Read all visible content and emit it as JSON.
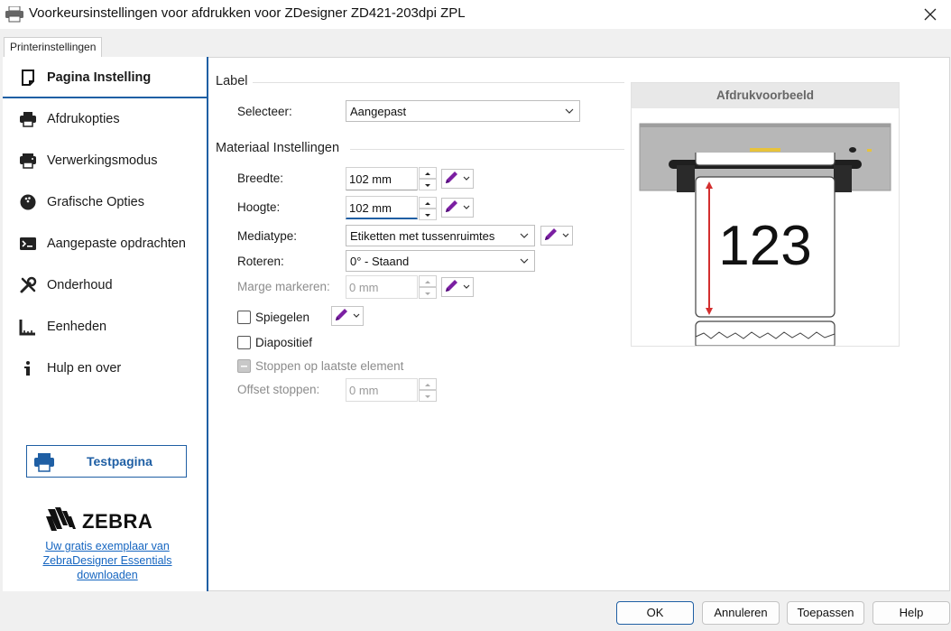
{
  "window": {
    "title": "Voorkeursinstellingen voor afdrukken voor ZDesigner ZD421-203dpi ZPL"
  },
  "tabs": [
    {
      "label": "Printerinstellingen"
    }
  ],
  "sidebar": {
    "items": [
      {
        "label": "Pagina Instelling",
        "icon": "page-icon",
        "active": true
      },
      {
        "label": "Afdrukopties",
        "icon": "printer-icon"
      },
      {
        "label": "Verwerkingsmodus",
        "icon": "printer-mode-icon"
      },
      {
        "label": "Grafische Opties",
        "icon": "bowling-ball-icon"
      },
      {
        "label": "Aangepaste opdrachten",
        "icon": "terminal-icon"
      },
      {
        "label": "Onderhoud",
        "icon": "tools-icon"
      },
      {
        "label": "Eenheden",
        "icon": "ruler-icon"
      },
      {
        "label": "Hulp en over",
        "icon": "info-icon"
      }
    ],
    "test_button": "Testpagina",
    "brand": "ZEBRA",
    "download_link": "Uw gratis exemplaar van ZebraDesigner Essentials downloaden"
  },
  "label_section": {
    "title": "Label",
    "select_label": "Selecteer:",
    "select_value": "Aangepast"
  },
  "material_section": {
    "title": "Materiaal Instellingen",
    "width_label": "Breedte:",
    "width_value": "102 mm",
    "height_label": "Hoogte:",
    "height_value": "102 mm",
    "mediatype_label": "Mediatype:",
    "mediatype_value": "Etiketten met tussenruimtes",
    "rotate_label": "Roteren:",
    "rotate_value": "0° - Staand",
    "margin_label": "Marge markeren:",
    "margin_value": "0 mm",
    "mirror_label": "Spiegelen",
    "mirror_checked": false,
    "transparency_label": "Diapositief",
    "transparency_checked": false,
    "stop_last_label": "Stoppen op laatste element",
    "stop_offset_label": "Offset stoppen:",
    "stop_offset_value": "0 mm"
  },
  "preview": {
    "title": "Afdrukvoorbeeld",
    "sample_text": "123"
  },
  "footer": {
    "ok": "OK",
    "cancel": "Annuleren",
    "apply": "Toepassen",
    "help": "Help"
  },
  "colors": {
    "accent": "#1f5fa4",
    "link": "#1565c0",
    "pen": "#7b1fa2",
    "dimension_arrow": "#d32f2f"
  }
}
